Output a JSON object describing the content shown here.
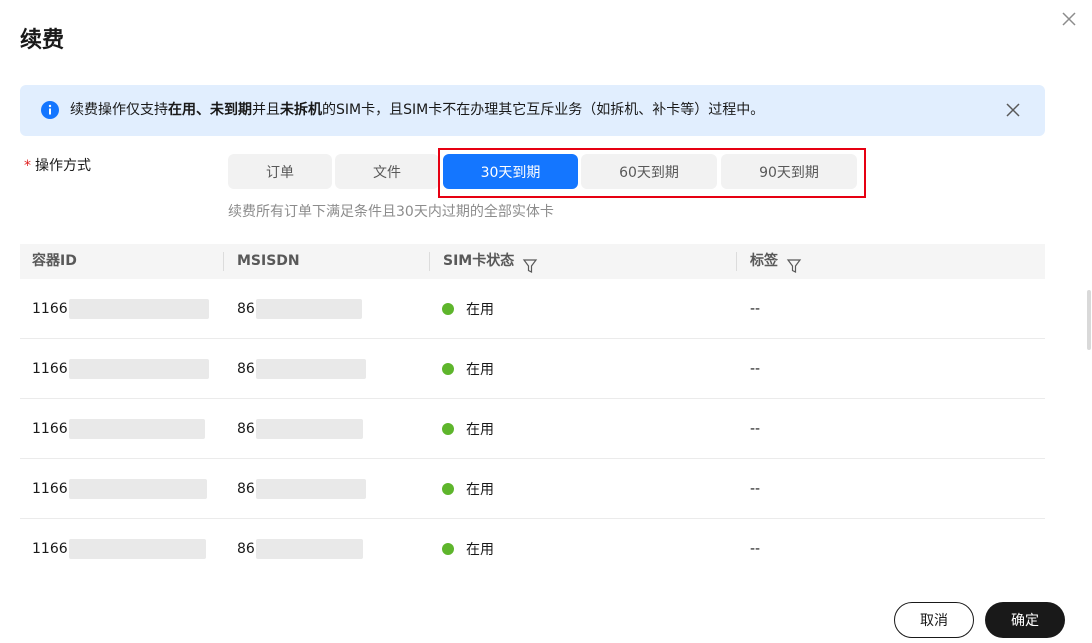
{
  "dialog": {
    "title": "续费",
    "close_icon": "close-icon"
  },
  "notice": {
    "icon": "info-icon",
    "text_parts": [
      "续费操作仅支持",
      "在用、未到期",
      "并且",
      "未拆机",
      "的SIM卡，且SIM卡不在办理其它互斥业务（如拆机、补卡等）过程中。"
    ],
    "info_color": "#1476ff"
  },
  "form": {
    "required_mark": "*",
    "label": "操作方式",
    "options": [
      "订单",
      "文件",
      "30天到期",
      "60天到期",
      "90天到期"
    ],
    "selected": "30天到期",
    "hint": "续费所有订单下满足条件且30天内过期的全部实体卡"
  },
  "table": {
    "columns": [
      "容器ID",
      "MSISDN",
      "SIM卡状态",
      "标签"
    ],
    "rows": [
      {
        "container_id": "1166",
        "msisdn": "86",
        "status": "在用",
        "tag": "--"
      },
      {
        "container_id": "1166",
        "msisdn": "86",
        "status": "在用",
        "tag": "--"
      },
      {
        "container_id": "1166",
        "msisdn": "86",
        "status": "在用",
        "tag": "--"
      },
      {
        "container_id": "1166",
        "msisdn": "86",
        "status": "在用",
        "tag": "--"
      },
      {
        "container_id": "1166",
        "msisdn": "86",
        "status": "在用",
        "tag": "--"
      }
    ],
    "status_color": "#5eb52c"
  },
  "footer": {
    "cancel_label": "取消",
    "confirm_label": "确定"
  },
  "colors": {
    "accent": "#1476ff",
    "highlight": "#e60012",
    "required": "#e02020"
  }
}
